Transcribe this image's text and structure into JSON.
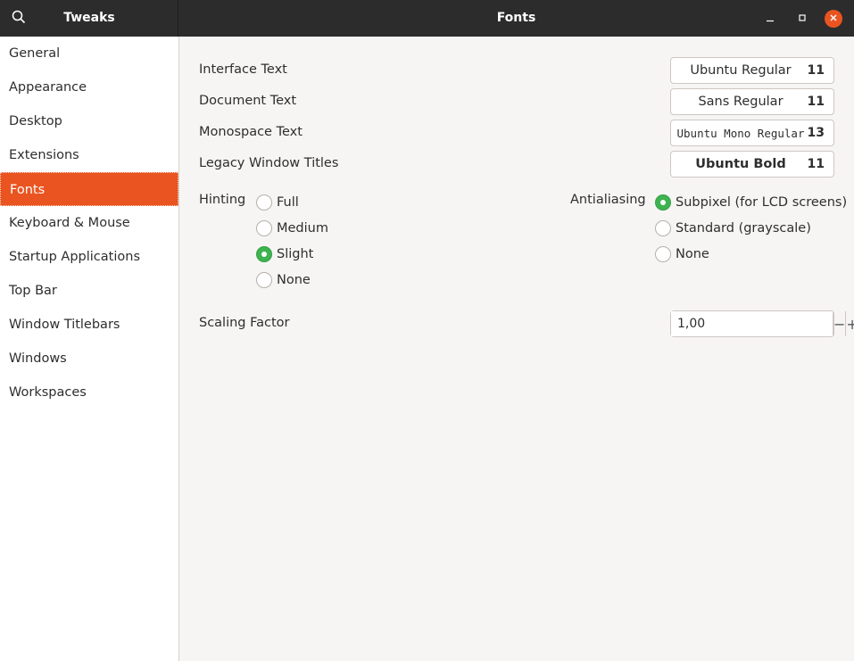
{
  "header": {
    "app_title": "Tweaks",
    "page_title": "Fonts",
    "search_icon": "search-icon",
    "accent": "#e95420"
  },
  "sidebar": {
    "items": [
      {
        "label": "General"
      },
      {
        "label": "Appearance"
      },
      {
        "label": "Desktop"
      },
      {
        "label": "Extensions"
      },
      {
        "label": "Fonts",
        "active": true
      },
      {
        "label": "Keyboard & Mouse"
      },
      {
        "label": "Startup Applications"
      },
      {
        "label": "Top Bar"
      },
      {
        "label": "Window Titlebars"
      },
      {
        "label": "Windows"
      },
      {
        "label": "Workspaces"
      }
    ]
  },
  "fonts": {
    "rows": [
      {
        "label": "Interface Text",
        "font": "Ubuntu Regular",
        "size": "11"
      },
      {
        "label": "Document Text",
        "font": "Sans Regular",
        "size": "11"
      },
      {
        "label": "Monospace Text",
        "font": "Ubuntu Mono Regular",
        "size": "13"
      },
      {
        "label": "Legacy Window Titles",
        "font": "Ubuntu Bold",
        "size": "11"
      }
    ]
  },
  "hinting": {
    "label": "Hinting",
    "options": [
      "Full",
      "Medium",
      "Slight",
      "None"
    ],
    "selected": "Slight"
  },
  "antialiasing": {
    "label": "Antialiasing",
    "options": [
      "Subpixel (for LCD screens)",
      "Standard (grayscale)",
      "None"
    ],
    "selected": "Subpixel (for LCD screens)"
  },
  "scaling": {
    "label": "Scaling Factor",
    "value": "1,00",
    "minus": "−",
    "plus": "+"
  },
  "colors": {
    "selected_radio": "#3eb34f",
    "close_button": "#e95420"
  }
}
